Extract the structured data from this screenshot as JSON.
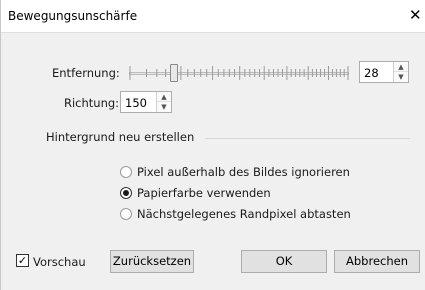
{
  "window": {
    "title": "Bewegungsunschärfe",
    "close_glyph": "✕"
  },
  "distance": {
    "label": "Entfernung:",
    "value": "28",
    "slider_fraction": 0.2
  },
  "direction": {
    "label": "Richtung:",
    "value": "150"
  },
  "background_group": {
    "label": "Hintergrund neu erstellen",
    "options": [
      {
        "label": "Pixel außerhalb des Bildes ignorieren",
        "checked": false
      },
      {
        "label": "Papierfarbe verwenden",
        "checked": true
      },
      {
        "label": "Nächstgelegenes Randpixel abtasten",
        "checked": false
      }
    ]
  },
  "footer": {
    "preview_label": "Vorschau",
    "preview_checked": true,
    "check_glyph": "✓",
    "reset_label": "Zurücksetzen",
    "ok_label": "OK",
    "cancel_label": "Abbrechen"
  },
  "icons": {
    "spin_up": "▲",
    "spin_down": "▼"
  }
}
